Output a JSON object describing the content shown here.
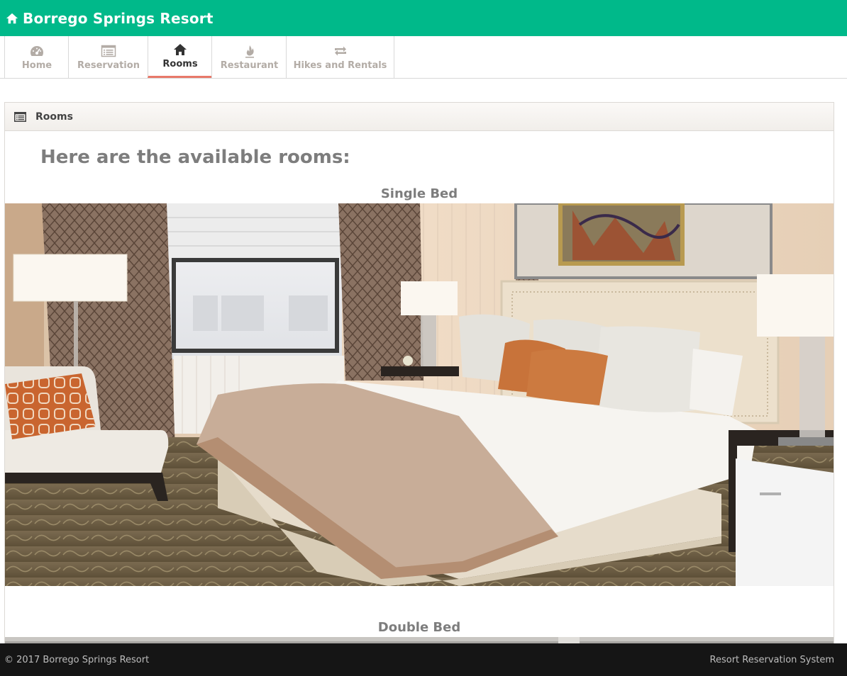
{
  "header": {
    "brand": "Borrego Springs Resort",
    "icon": "home-icon",
    "color": "#00b98a"
  },
  "tabs": [
    {
      "label": "Home",
      "icon": "dashboard-icon",
      "active": false
    },
    {
      "label": "Reservation",
      "icon": "list-icon",
      "active": false
    },
    {
      "label": "Rooms",
      "icon": "home-icon",
      "active": true
    },
    {
      "label": "Restaurant",
      "icon": "fire-icon",
      "active": false
    },
    {
      "label": "Hikes and Rentals",
      "icon": "retweet-icon",
      "active": false
    }
  ],
  "panel": {
    "title": "Rooms",
    "icon": "list-icon",
    "intro": "Here are the available rooms:"
  },
  "rooms": [
    {
      "name": "Single Bed"
    },
    {
      "name": "Double Bed"
    }
  ],
  "footer": {
    "copyright": "© 2017 Borrego Springs Resort",
    "system": "Resort Reservation System"
  },
  "colors": {
    "accent": "#00b98a",
    "active_tab_underline": "#e8796a",
    "footer_bg": "#151515"
  }
}
